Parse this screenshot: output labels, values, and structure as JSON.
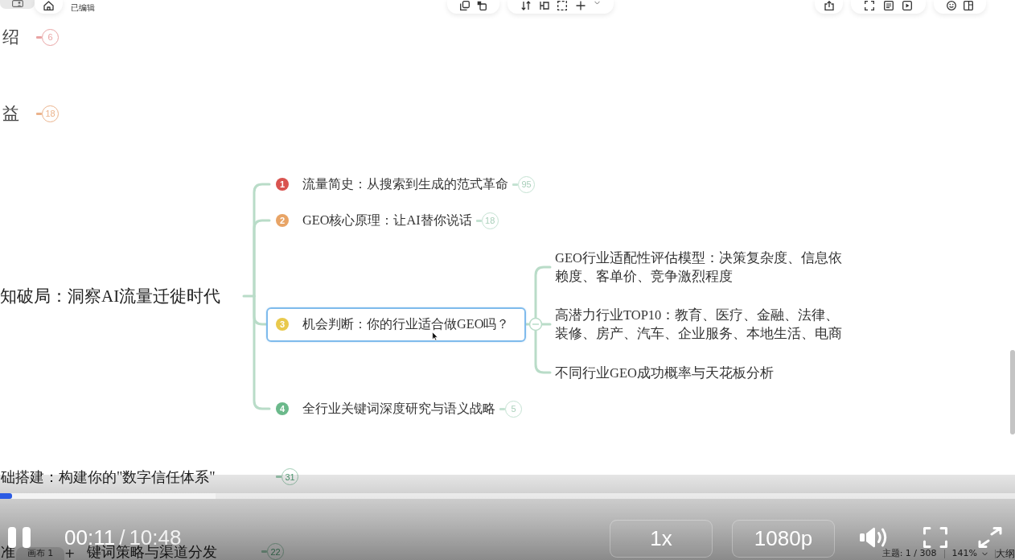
{
  "top_bar": {
    "status": "已编辑"
  },
  "mindmap": {
    "partial_topics": [
      {
        "text": "绍",
        "badge": "6",
        "color": "#e9a4a4"
      },
      {
        "text": "益",
        "badge": "18",
        "color": "#ebb38c"
      }
    ],
    "central_topic": {
      "text": "知破局：洞察AI流量迁徙时代",
      "children": [
        {
          "number": "1",
          "color": "#d9534f",
          "text": "流量简史：从搜索到生成的范式革命",
          "badge": "95",
          "selected": false,
          "expanded": false
        },
        {
          "number": "2",
          "color": "#e8a466",
          "text": "GEO核心原理：让AI替你说话",
          "badge": "18",
          "selected": false,
          "expanded": false
        },
        {
          "number": "3",
          "color": "#e9c94c",
          "text": "机会判断：你的行业适合做GEO吗？",
          "selected": true,
          "expanded": true,
          "children": [
            {
              "text": "GEO行业适配性评估模型：决策复杂度、信息依赖度、客单价、竞争激烈程度"
            },
            {
              "text": "高潜力行业TOP10：教育、医疗、金融、法律、装修、房产、汽车、企业服务、本地生活、电商"
            },
            {
              "text": "不同行业GEO成功概率与天花板分析"
            }
          ]
        },
        {
          "number": "4",
          "color": "#6bb98b",
          "text": "全行业关键词深度研究与语义战略",
          "badge": "5",
          "selected": false,
          "expanded": false
        }
      ]
    },
    "next_topics": [
      {
        "parts": [
          "础搭建：构建你的\"数字信任体系\""
        ],
        "badge": "31"
      },
      {
        "parts": [
          "准",
          "键词策略与渠道分发"
        ],
        "badge": "22"
      }
    ]
  },
  "canvas_bar": {
    "tabs": [
      {
        "label": "画布 1",
        "selected": true
      }
    ],
    "add": "+",
    "topic_count": "主题: 1 / 308",
    "zoom": "141%",
    "outline": "大纲"
  },
  "video_player": {
    "progress": {
      "level": 0.012,
      "buffer": {
        "level": 0.212
      }
    },
    "playing": true,
    "current_time": "00:11",
    "separator": "/",
    "duration": "10:48",
    "speed": "1x",
    "quality": "1080p",
    "muted": false
  }
}
